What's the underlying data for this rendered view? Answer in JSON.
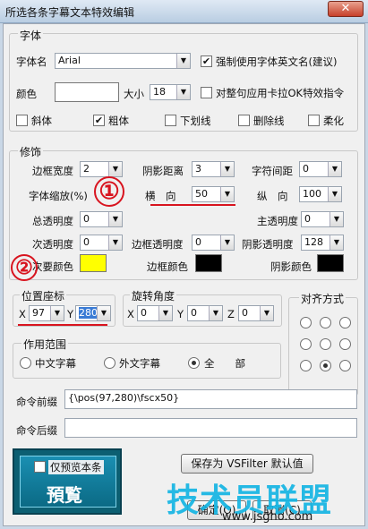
{
  "window": {
    "title": "所选各条字幕文本特效编辑",
    "close_glyph": "✕"
  },
  "font_group": {
    "legend": "字体",
    "font_name_label": "字体名",
    "font_name_value": "Arial",
    "force_english_label": "强制使用字体英文名(建议)",
    "color_label": "颜色",
    "size_label": "大小",
    "size_value": "18",
    "karaoke_label": "对整句应用卡拉OK特效指令",
    "italic_label": "斜体",
    "bold_label": "粗体",
    "underline_label": "下划线",
    "strike_label": "删除线",
    "soft_label": "柔化",
    "font_color": "#ffffff"
  },
  "decor_group": {
    "legend": "修饰",
    "border_width_label": "边框宽度",
    "border_width_value": "2",
    "shadow_dist_label": "阴影距离",
    "shadow_dist_value": "3",
    "char_spacing_label": "字符间距",
    "char_spacing_value": "0",
    "scale_label": "字体缩放(%)",
    "scale_h_label": "横　向",
    "scale_h_value": "50",
    "scale_v_label": "纵　向",
    "scale_v_value": "100",
    "total_alpha_label": "总透明度",
    "total_alpha_value": "0",
    "primary_alpha_label": "主透明度",
    "primary_alpha_value": "0",
    "secondary_alpha_label": "次透明度",
    "secondary_alpha_value": "0",
    "border_alpha_label": "边框透明度",
    "border_alpha_value": "0",
    "shadow_alpha_label": "阴影透明度",
    "shadow_alpha_value": "128",
    "secondary_color_label": "次要颜色",
    "border_color_label": "边框颜色",
    "shadow_color_label": "阴影颜色",
    "secondary_color": "#ffff00",
    "border_color": "#000000",
    "shadow_color": "#000000"
  },
  "position_group": {
    "legend": "位置座标",
    "x_label": "X",
    "x_value": "97",
    "y_label": "Y",
    "y_value": "280"
  },
  "rotation_group": {
    "legend": "旋转角度",
    "x_label": "X",
    "x_value": "0",
    "y_label": "Y",
    "y_value": "0",
    "z_label": "Z",
    "z_value": "0"
  },
  "align_group": {
    "legend": "对齐方式"
  },
  "scope_group": {
    "legend": "作用范围",
    "chinese_label": "中文字幕",
    "foreign_label": "外文字幕",
    "all_label": "全　　部"
  },
  "command_prefix": {
    "label": "命令前缀",
    "value": "{\\pos(97,280)\\fscx50}"
  },
  "command_suffix": {
    "label": "命令后缀",
    "value": ""
  },
  "preview": {
    "only_text_label": "仅预览本条",
    "preview_text": "預覧"
  },
  "buttons": {
    "save_vsfilter": "保存为 VSFilter 默认值",
    "ok": "确定(O)",
    "cancel": "取消(C)"
  },
  "annotations": {
    "one": "①",
    "two": "②"
  },
  "watermark": {
    "brand": "技术员联盟",
    "url": "www.jsgho.com"
  }
}
